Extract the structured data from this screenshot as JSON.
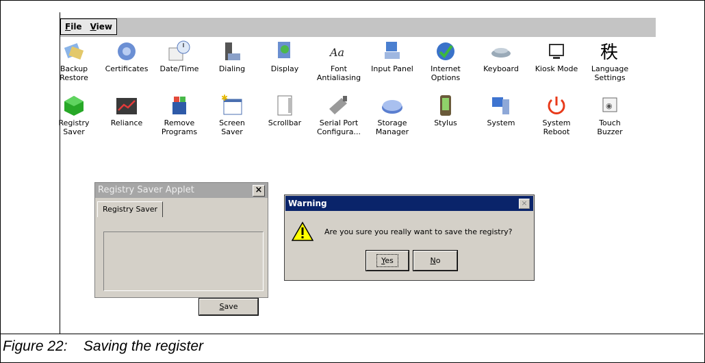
{
  "menu": {
    "items": [
      {
        "label": "File",
        "key": "F"
      },
      {
        "label": "View",
        "key": "V"
      }
    ]
  },
  "icons": [
    {
      "label": "Backup\nRestore",
      "icon": "backup-restore-icon"
    },
    {
      "label": "Certificates",
      "icon": "certificates-icon"
    },
    {
      "label": "Date/Time",
      "icon": "date-time-icon"
    },
    {
      "label": "Dialing",
      "icon": "dialing-icon"
    },
    {
      "label": "Display",
      "icon": "display-icon"
    },
    {
      "label": "Font\nAntialiasing",
      "icon": "font-antialiasing-icon"
    },
    {
      "label": "Input Panel",
      "icon": "input-panel-icon"
    },
    {
      "label": "Internet\nOptions",
      "icon": "internet-options-icon"
    },
    {
      "label": "Keyboard",
      "icon": "keyboard-icon"
    },
    {
      "label": "Kiosk Mode",
      "icon": "kiosk-mode-icon"
    },
    {
      "label": "Language\nSettings",
      "icon": "language-settings-icon"
    },
    {
      "label": "Registry\nSaver",
      "icon": "registry-saver-icon"
    },
    {
      "label": "Reliance",
      "icon": "reliance-icon"
    },
    {
      "label": "Remove\nPrograms",
      "icon": "remove-programs-icon"
    },
    {
      "label": "Screen\nSaver",
      "icon": "screen-saver-icon"
    },
    {
      "label": "Scrollbar",
      "icon": "scrollbar-icon"
    },
    {
      "label": "Serial Port\nConfigura...",
      "icon": "serial-port-icon"
    },
    {
      "label": "Storage\nManager",
      "icon": "storage-manager-icon"
    },
    {
      "label": "Stylus",
      "icon": "stylus-icon"
    },
    {
      "label": "System",
      "icon": "system-icon"
    },
    {
      "label": "System\nReboot",
      "icon": "system-reboot-icon"
    },
    {
      "label": "Touch\nBuzzer",
      "icon": "touch-buzzer-icon"
    }
  ],
  "registry_window": {
    "title": "Registry Saver Applet",
    "close": "×",
    "tab": "Registry Saver",
    "save_label": "Save"
  },
  "warning_dialog": {
    "title": "Warning",
    "close": "×",
    "message": "Are you sure you really want to save the registry?",
    "yes_label": "Yes",
    "no_label": "No"
  },
  "caption": "Figure 22:    Saving the register",
  "colors": {
    "title_active": "#0a246a",
    "title_inactive": "#a6a6a6",
    "face": "#d4d0c8"
  }
}
